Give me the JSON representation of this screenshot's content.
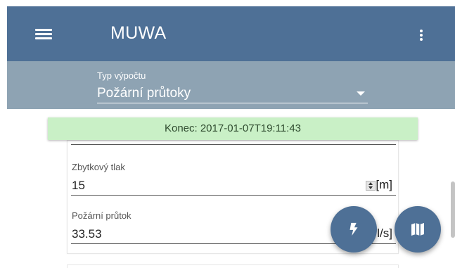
{
  "app": {
    "title": "MUWA"
  },
  "calc_type": {
    "label": "Typ výpočtu",
    "value": "Požární průtoky"
  },
  "status": {
    "text": "Konec: 2017-01-07T19:11:43",
    "color": "#c9f0c6"
  },
  "fields": {
    "residual_pressure": {
      "label": "Zbytkový tlak",
      "value": "15",
      "unit": "[m]"
    },
    "fire_flow": {
      "label": "Požární průtok",
      "value": "33.53",
      "unit": "l/s]"
    }
  },
  "fabs": {
    "bolt": "lightning-icon",
    "map": "map-icon"
  },
  "colors": {
    "primary": "#4e7096",
    "selector_band": "#8ea3b3"
  }
}
